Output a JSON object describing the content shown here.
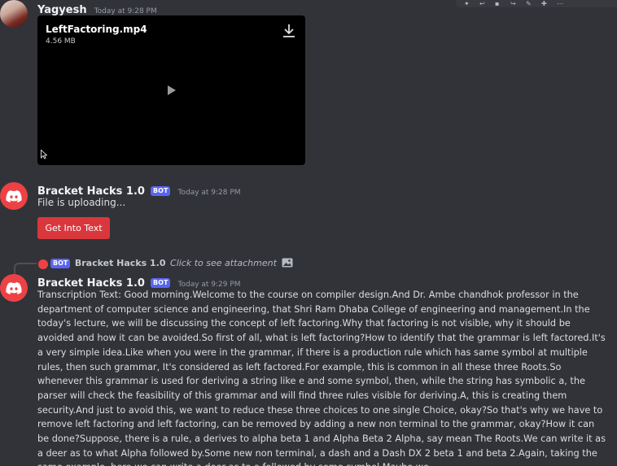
{
  "colors": {
    "background": "#313338",
    "bot_tag": "#5865f2",
    "button": "#da373c",
    "discord_avatar": "#ed4245",
    "timestamp": "#949ba4"
  },
  "message1": {
    "username": "Yagyesh",
    "timestamp": "Today at 9:28 PM",
    "attachment": {
      "filename": "LeftFactoring.mp4",
      "size": "4.56 MB",
      "download_icon": "download-icon",
      "play_icon": "play-icon"
    }
  },
  "message2": {
    "username": "Bracket Hacks 1.0",
    "bot_tag": "BOT",
    "timestamp": "Today at 9:28 PM",
    "text": "File is uploading...",
    "button_label": "Get Into Text"
  },
  "message3": {
    "reply": {
      "bot_tag": "BOT",
      "username": "Bracket Hacks 1.0",
      "text": "Click to see attachment",
      "icon": "image-icon"
    },
    "username": "Bracket Hacks 1.0",
    "bot_tag": "BOT",
    "timestamp": "Today at 9:29 PM",
    "text": "Transcription Text: Good morning.Welcome to the course on compiler design.And Dr. Ambe chandhok professor in the department of computer science and engineering, that Shri Ram Dhaba College of engineering and management.In the today's lecture, we will be discussing the concept of left factoring.Why that factoring is not visible, why it should be avoided and how it can be avoided.So first of all, what is left factoring?How to identify that the grammar is left factored.It's a very simple idea.Like when you were in the grammar, if there is a production rule which has same symbol at multiple rules, then such grammar, It's considered as left factored.For example, this is common in all these three Roots.So whenever this grammar is used for deriving a string like e and some symbol, then, while the string has symbolic a, the parser will check the feasibility of this grammar and will find three rules visible for deriving.A, this is creating them security.And just to avoid this, we want to reduce these three choices to one single Choice, okay?So that's why we have to remove left factoring and left factoring, can be removed by adding a new non terminal to the grammar, okay?How it can be done?Suppose, there is a rule, a derives to alpha beta 1 and Alpha Beta 2 Alpha, say mean The Roots.We can write it as a deer as to what Alpha followed by.Some new non terminal, a dash and a Dash DX 2 beta 1 and beta 2.Again, taking the same example, here we can write a deer as to a followed by some symbol.Maybe we"
  }
}
